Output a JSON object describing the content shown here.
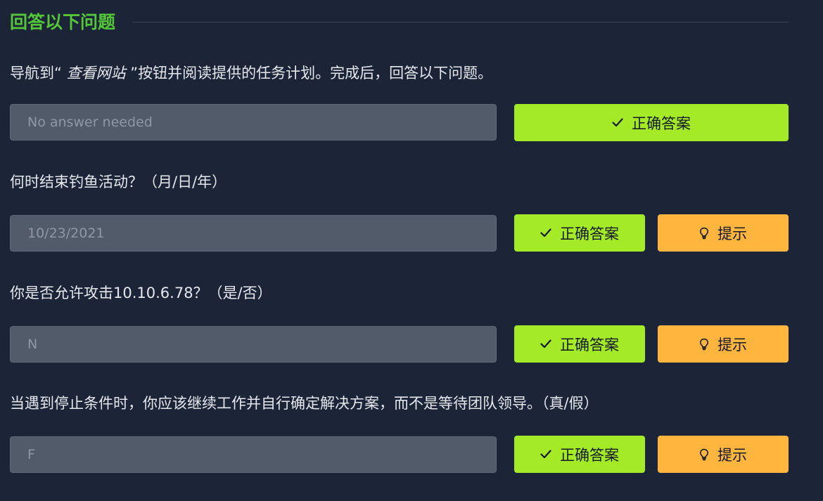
{
  "section": {
    "title": "回答以下问题"
  },
  "questions": [
    {
      "text_before": "导航到“ ",
      "text_emph": "查看网站",
      "text_after": " ”按钮并阅读提供的任务计划。完成后，回答以下问题。",
      "answer": "No answer needed",
      "correct_label": "正确答案"
    },
    {
      "text": "何时结束钓鱼活动？（月/日/年）",
      "answer": "10/23/2021",
      "correct_label": "正确答案",
      "hint_label": "提示"
    },
    {
      "text": "你是否允许攻击10.10.6.78？（是/否）",
      "answer": "N",
      "correct_label": "正确答案",
      "hint_label": "提示"
    },
    {
      "text": "当遇到停止条件时，你应该继续工作并自行确定解决方案，而不是等待团队领导。（真/假）",
      "answer": "F",
      "correct_label": "正确答案",
      "hint_label": "提示"
    }
  ],
  "icons": {
    "correct": "check-icon",
    "hint": "lightbulb-icon"
  },
  "colors": {
    "background": "#1c2538",
    "title": "#54c738",
    "correct_button": "#a4ea27",
    "hint_button": "#ffb53e",
    "answer_box": "#525b6a"
  }
}
